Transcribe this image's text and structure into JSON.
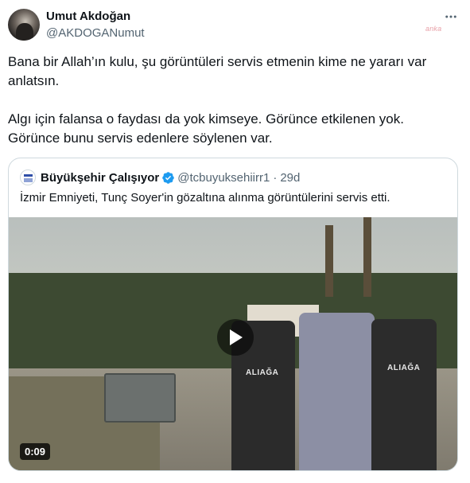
{
  "tweet": {
    "author_name": "Umut Akdoğan",
    "author_handle": "@AKDOGANumut",
    "paragraph_1": "Bana bir Allah’ın kulu, şu görüntüleri servis etmenin kime ne yararı var\nanlatsın.",
    "paragraph_2": "Algı için falansa o faydası da yok kimseye. Görünce etkilenen yok.\nGörünce bunu servis edenlere söylenen var.",
    "watermark": "anka"
  },
  "quoted": {
    "author_name": "Büyükşehir Çalışıyor",
    "author_handle": "@tcbuyuksehiirr1",
    "separator": "·",
    "time": "29d",
    "text": "İzmir Emniyeti, Tunç Soyer'in gözaltına alınma görüntülerini servis etti.",
    "video_duration": "0:09",
    "vest_text_left": "ALIAĞA",
    "vest_text_right": "ALIAĞA"
  },
  "icons": {
    "more": "more-dots-icon",
    "verified": "verified-badge-icon",
    "play": "play-icon"
  },
  "colors": {
    "text_primary": "#0f1419",
    "text_secondary": "#536471",
    "verified_blue": "#1d9bf0",
    "border": "#cfd9de"
  }
}
